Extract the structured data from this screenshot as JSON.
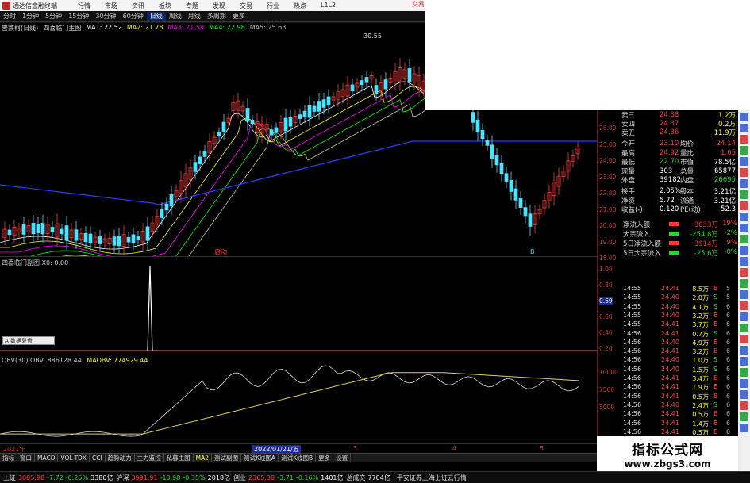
{
  "titlebar": {
    "title": "通达信金融终端",
    "menu": [
      "行情",
      "市场",
      "资讯",
      "板块",
      "专题",
      "发现",
      "交易",
      "行业",
      "热点",
      "L1L2"
    ],
    "right": "交易"
  },
  "periods": [
    "分时",
    "1分钟",
    "5分钟",
    "15分钟",
    "30分钟",
    "60分钟",
    "日线",
    "周线",
    "月线",
    "多周期",
    "更多"
  ],
  "active_period": "日线",
  "main_chart": {
    "stock": "普莱柯(日线)",
    "indicator": "四喜临门主图",
    "ma": [
      {
        "name": "MA1",
        "value": "22.52",
        "color": "#ffffff"
      },
      {
        "name": "MA2",
        "value": "21.78",
        "color": "#ffff00"
      },
      {
        "name": "MA3",
        "value": "21.59",
        "color": "#ff00ff"
      },
      {
        "name": "MA4",
        "value": "22.98",
        "color": "#00ff00"
      },
      {
        "name": "MA5",
        "value": "25.63",
        "color": "#bbbbbb"
      }
    ],
    "peak_label": "30.55",
    "signal_label": "启动",
    "buy_label": "B"
  },
  "sub1": {
    "label": "四喜临门副图 X0: 0.00",
    "tag": "A 数据复盘"
  },
  "sub2": {
    "obv_label": "OBV(30) OBV: 886128.44",
    "maobv_label": "MAOBV: 774929.44"
  },
  "date_axis": {
    "start": "2021年",
    "highlight": "2022/01/21/五",
    "marks": [
      "3",
      "4",
      "5"
    ]
  },
  "tabs": [
    "指标",
    "窗口",
    "MACD",
    "VOL-TDX",
    "CCI",
    "趋势动力",
    "主力监控",
    "私募主图",
    "MA2",
    "测试副图",
    "测试K线图A",
    "测试K线图B",
    "更多",
    "设置"
  ],
  "active_tab": "MA2",
  "status_bar": {
    "sh_label": "上证",
    "sh_value": "3085.98",
    "sh_chg": "-7.72",
    "sh_pct": "-0.25%",
    "sh_amt": "3380亿",
    "sz_label": "沪深",
    "sz_value": "3991.91",
    "sz_chg": "-13.98",
    "sz_pct": "-0.35%",
    "sz_amt": "2018亿",
    "cy_label": "创业",
    "cy_value": "2365.38",
    "cy_chg": "-3.71",
    "cy_pct": "-0.16%",
    "cy_amt": "1401亿",
    "total_label": "总成交",
    "total_value": "7704亿",
    "broker": "平安证券上海上证云行情"
  },
  "price_axis": [
    "26.00",
    "25.00",
    "24.00",
    "23.00",
    "22.00",
    "21.00",
    "20.00",
    "19.00",
    "18.00"
  ],
  "sub1_axis": [
    "1.00",
    "0.80",
    "0.69",
    "0.60",
    "0.40",
    "0.20"
  ],
  "sub2_axis": [
    "10000",
    "7500",
    "5000"
  ],
  "quote": {
    "asks": [
      {
        "k": "卖三",
        "v": "24.38",
        "vol": "1.2万"
      },
      {
        "k": "卖四",
        "v": "24.37",
        "vol": "0.2万"
      },
      {
        "k": "卖五",
        "v": "24.36",
        "vol": "11.9万"
      }
    ],
    "stats": [
      {
        "k1": "今开",
        "v1": "23.10",
        "k2": "均价",
        "v2": "24.14"
      },
      {
        "k1": "最高",
        "v1": "24.92",
        "k2": "量比",
        "v2": "1.65"
      },
      {
        "k1": "最低",
        "v1": "22.70",
        "k2": "市值",
        "v2": "78.5亿"
      },
      {
        "k1": "现量",
        "v1": "303",
        "k2": "总量",
        "v2": "65877"
      },
      {
        "k1": "外盘",
        "v1": "39182",
        "k2": "内盘",
        "v2": "26695"
      },
      {
        "k1": "换手",
        "v1": "2.05%",
        "k2": "股本",
        "v2": "3.21亿"
      },
      {
        "k1": "净资",
        "v1": "5.72",
        "k2": "流通",
        "v2": "3.21亿"
      },
      {
        "k1": "收益(-)",
        "v1": "0.120",
        "k2": "PE(动)",
        "v2": "52.3"
      }
    ],
    "flows": [
      {
        "label": "净流入额",
        "value": "3033万",
        "pct": "19%",
        "color": "#ff3a3a"
      },
      {
        "label": "大宗流入",
        "value": "-254.8万",
        "pct": "-2%",
        "color": "#26d926"
      },
      {
        "label": "5日净流入额",
        "value": "3914万",
        "pct": "9%",
        "color": "#ff3a3a"
      },
      {
        "label": "5日大宗流入",
        "value": "-25.6万",
        "pct": "-0%",
        "color": "#26d926"
      }
    ],
    "ticks": [
      {
        "t": "14:55",
        "p": "24.41",
        "v": "8.5万",
        "s": "B",
        "n": "5"
      },
      {
        "t": "14:55",
        "p": "24.40",
        "v": "2.0万",
        "s": "S",
        "n": "5"
      },
      {
        "t": "14:55",
        "p": "24.40",
        "v": "4.1万",
        "s": "S",
        "n": "6"
      },
      {
        "t": "14:55",
        "p": "24.40",
        "v": "3.2万",
        "s": "B",
        "n": "6"
      },
      {
        "t": "14:55",
        "p": "24.41",
        "v": "3.7万",
        "s": "B",
        "n": "6"
      },
      {
        "t": "14:56",
        "p": "24.41",
        "v": "0.7万",
        "s": "S",
        "n": "6"
      },
      {
        "t": "14:56",
        "p": "24.40",
        "v": "4.9万",
        "s": "B",
        "n": "6"
      },
      {
        "t": "14:56",
        "p": "24.41",
        "v": "3.2万",
        "s": "B",
        "n": "6"
      },
      {
        "t": "14:56",
        "p": "24.40",
        "v": "1.0万",
        "s": "S",
        "n": "6"
      },
      {
        "t": "14:56",
        "p": "24.40",
        "v": "1.5万",
        "s": "S",
        "n": "6"
      },
      {
        "t": "14:56",
        "p": "24.41",
        "v": "3.4万",
        "s": "B",
        "n": "6"
      },
      {
        "t": "14:56",
        "p": "24.41",
        "v": "1.9万",
        "s": "B",
        "n": "6"
      },
      {
        "t": "14:56",
        "p": "24.41",
        "v": "0.5万",
        "s": "B",
        "n": "6"
      },
      {
        "t": "14:56",
        "p": "24.40",
        "v": "2.4万",
        "s": "S",
        "n": "6"
      },
      {
        "t": "14:56",
        "p": "24.41",
        "v": "0.5万",
        "s": "B",
        "n": "6"
      },
      {
        "t": "14:56",
        "p": "24.41",
        "v": "1.4万",
        "s": "B",
        "n": "6"
      },
      {
        "t": "14:56",
        "p": "24.41",
        "v": "0.5万",
        "s": "B",
        "n": "6"
      },
      {
        "t": "14:56",
        "p": "24.41",
        "v": "0.1万",
        "s": "B",
        "n": "6"
      },
      {
        "t": "14:56",
        "p": "24.41",
        "v": "0.8万",
        "s": "B",
        "n": "6"
      }
    ]
  },
  "watermark": {
    "line1": "指标公式网",
    "line2": "www.zbgs3.com"
  }
}
